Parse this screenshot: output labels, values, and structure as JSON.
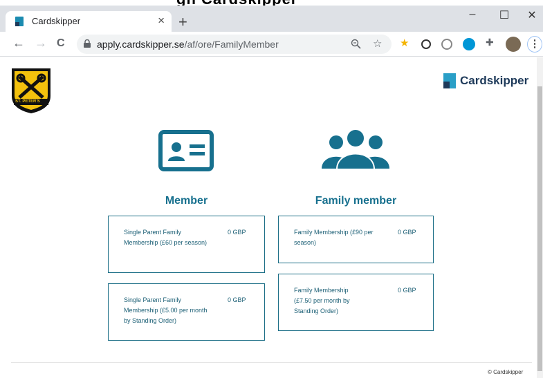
{
  "browser": {
    "title_strip_text": "gn Cardskipper",
    "tab_title": "Cardskipper",
    "tab_close": "×",
    "new_tab": "+",
    "window_controls": {
      "minimize": "–",
      "maximize": "☐",
      "close": "✕"
    },
    "nav": {
      "back": "←",
      "forward": "→",
      "reload": "C"
    },
    "url_domain": "apply.cardskipper.se",
    "url_path": "/af/ore/FamilyMember",
    "menu": "⋮"
  },
  "brand": {
    "name": "Cardskipper",
    "color": "#1b6e86"
  },
  "club_logo_text": "ST. PETER'S",
  "columns": [
    {
      "heading": "Member",
      "options": [
        {
          "name": "Single Parent Family Membership (£60 per season)",
          "price": "0 GBP"
        },
        {
          "name": "Single Parent Family Membership (£5.00 per month by Standing Order)",
          "price": "0 GBP"
        }
      ]
    },
    {
      "heading": "Family member",
      "options": [
        {
          "name": "Family Membership (£90 per season)",
          "price": "0 GBP"
        },
        {
          "name": "Family Membership (£7.50 per month by Standing Order)",
          "price": "0 GBP"
        }
      ]
    }
  ],
  "footer": "© Cardskipper"
}
